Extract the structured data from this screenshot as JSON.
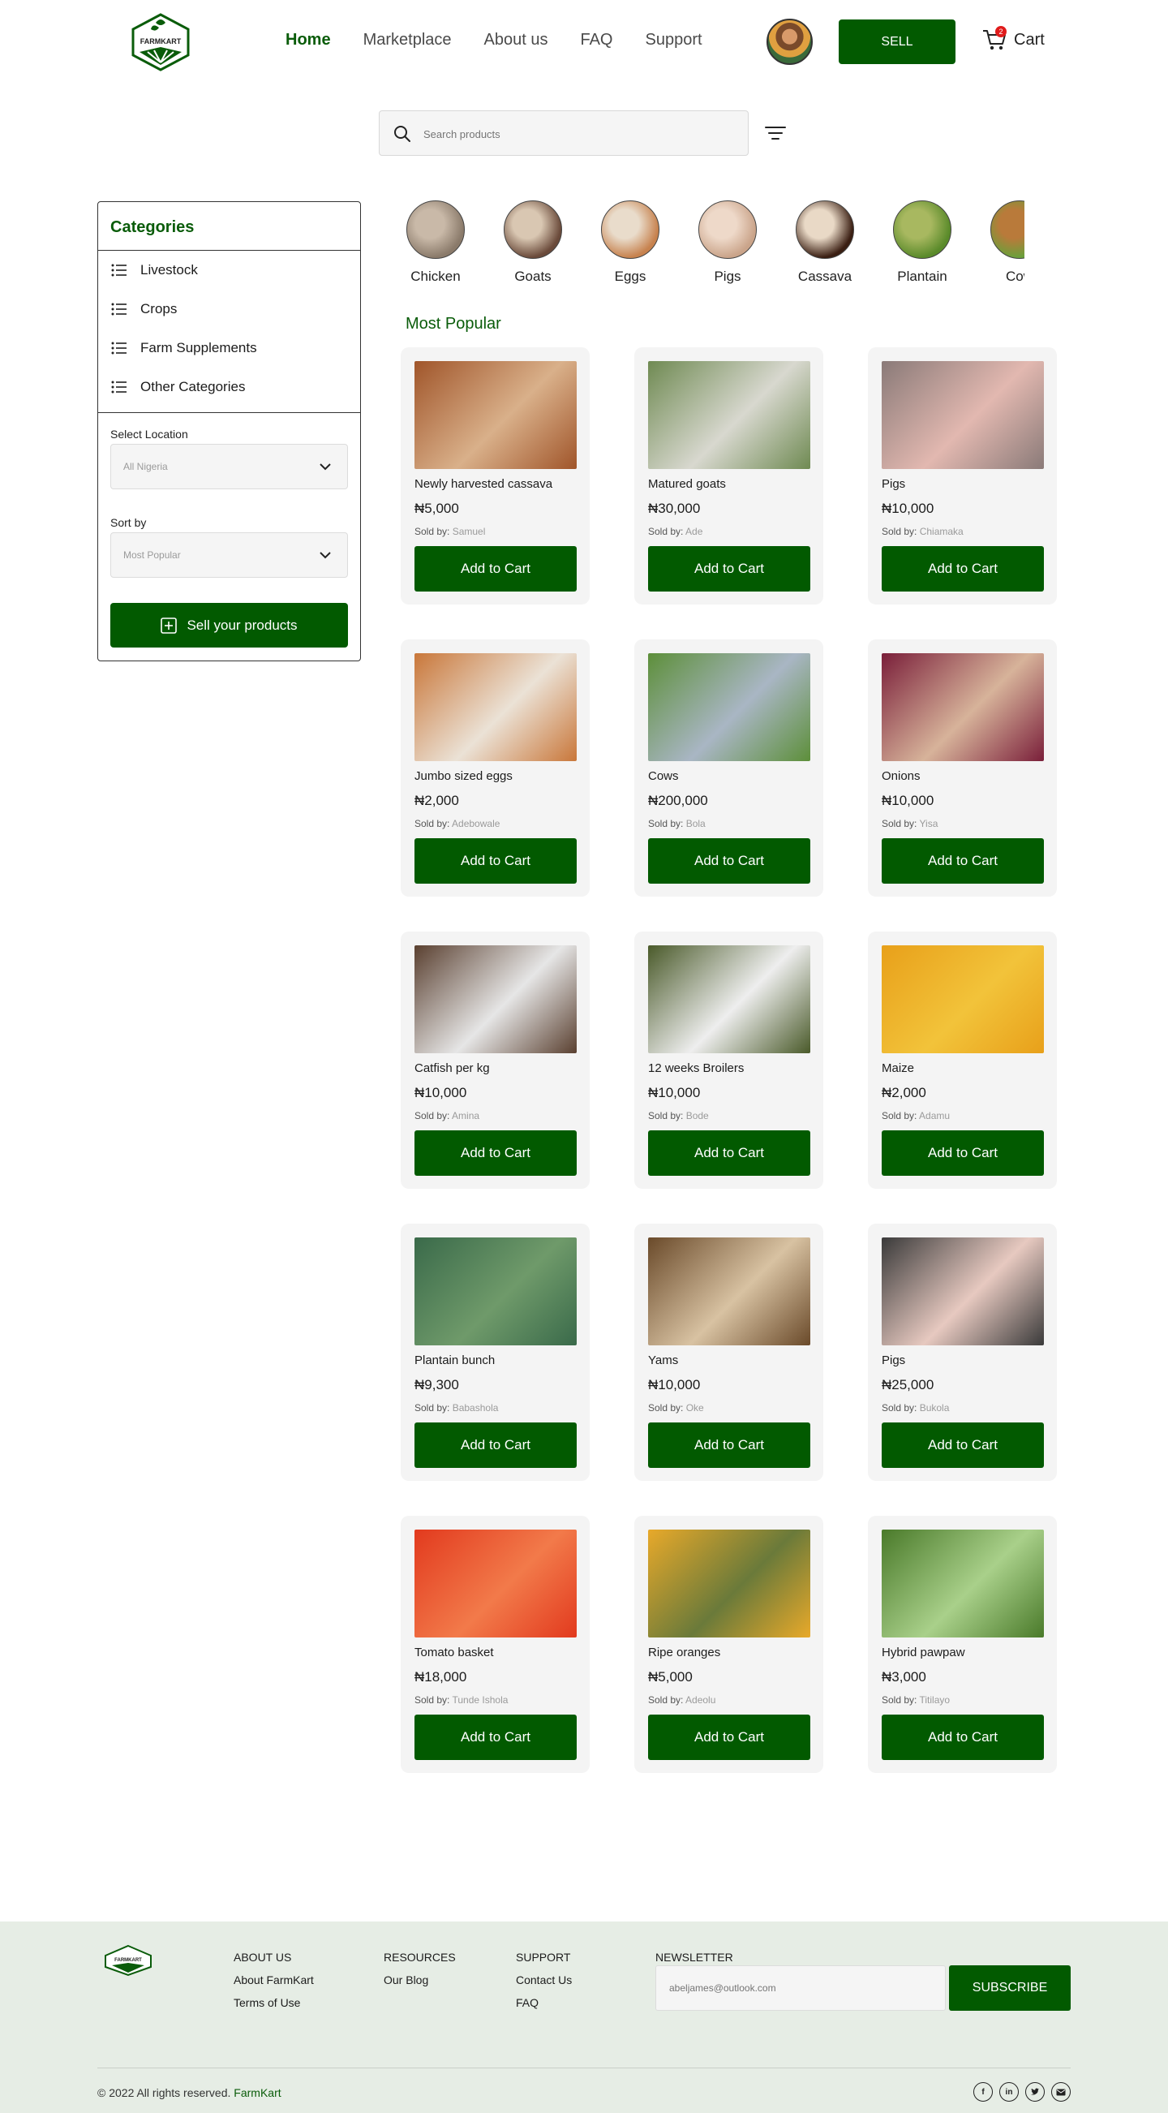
{
  "header": {
    "logo_text": "FARMKART",
    "nav": [
      {
        "label": "Home",
        "active": true
      },
      {
        "label": "Marketplace",
        "active": false
      },
      {
        "label": "About us",
        "active": false
      },
      {
        "label": "FAQ",
        "active": false
      },
      {
        "label": "Support",
        "active": false
      }
    ],
    "sell_label": "SELL",
    "cart_label": "Cart",
    "cart_count": "2"
  },
  "search": {
    "placeholder": "Search products"
  },
  "sidebar": {
    "title": "Categories",
    "categories": [
      "Livestock",
      "Crops",
      "Farm Supplements",
      "Other Categories"
    ],
    "location_label": "Select Location",
    "location_value": "All Nigeria",
    "sort_label": "Sort by",
    "sort_value": "Most Popular",
    "sell_button": "Sell your products"
  },
  "category_strip": [
    {
      "label": "Chicken",
      "colors": [
        "#8a7a6a",
        "#c9b9a8"
      ]
    },
    {
      "label": "Goats",
      "colors": [
        "#6a4a3a",
        "#d9c7b2"
      ]
    },
    {
      "label": "Eggs",
      "colors": [
        "#c7824e",
        "#e9dccb"
      ]
    },
    {
      "label": "Pigs",
      "colors": [
        "#caa48a",
        "#eed9c9"
      ]
    },
    {
      "label": "Cassava",
      "colors": [
        "#3a1e12",
        "#e9d9c6"
      ]
    },
    {
      "label": "Plantain",
      "colors": [
        "#5a8a2a",
        "#a8b860"
      ]
    },
    {
      "label": "Cow",
      "colors": [
        "#6aa03a",
        "#b97a3a"
      ]
    }
  ],
  "section_title": "Most Popular",
  "products": [
    {
      "title": "Newly harvested cassava",
      "price": "₦5,000",
      "seller": "Samuel",
      "colors": [
        "#a0552a",
        "#d9b08a"
      ]
    },
    {
      "title": "Matured goats",
      "price": "₦30,000",
      "seller": "Ade",
      "colors": [
        "#6f8a52",
        "#d8d8cf"
      ]
    },
    {
      "title": "Pigs",
      "price": "₦10,000",
      "seller": "Chiamaka",
      "colors": [
        "#8a7a78",
        "#e2b8b0"
      ]
    },
    {
      "title": "Jumbo sized eggs",
      "price": "₦2,000",
      "seller": "Adebowale",
      "colors": [
        "#c9773a",
        "#ebe2d6"
      ]
    },
    {
      "title": "Cows",
      "price": "₦200,000",
      "seller": "Bola",
      "colors": [
        "#5d8f3a",
        "#a9b6c4"
      ]
    },
    {
      "title": "Onions",
      "price": "₦10,000",
      "seller": "Yisa",
      "colors": [
        "#7a1f3a",
        "#d7b39a"
      ]
    },
    {
      "title": "Catfish per kg",
      "price": "₦10,000",
      "seller": "Amina",
      "colors": [
        "#5a4030",
        "#e6e6e6"
      ]
    },
    {
      "title": "12 weeks Broilers",
      "price": "₦10,000",
      "seller": "Bode",
      "colors": [
        "#4a5a2a",
        "#eeeeee"
      ]
    },
    {
      "title": "Maize",
      "price": "₦2,000",
      "seller": "Adamu",
      "colors": [
        "#e8a01a",
        "#f2c33a"
      ]
    },
    {
      "title": "Plantain bunch",
      "price": "₦9,300",
      "seller": "Babashola",
      "colors": [
        "#3a6a4a",
        "#6f9a6a"
      ]
    },
    {
      "title": "Yams",
      "price": "₦10,000",
      "seller": "Oke",
      "colors": [
        "#6a4a2a",
        "#d8c2a2"
      ]
    },
    {
      "title": "Pigs",
      "price": "₦25,000",
      "seller": "Bukola",
      "colors": [
        "#3a3a3a",
        "#e7c9c0"
      ]
    },
    {
      "title": "Tomato basket",
      "price": "₦18,000",
      "seller": "Tunde Ishola",
      "colors": [
        "#e23a1e",
        "#f27a4a"
      ]
    },
    {
      "title": "Ripe oranges",
      "price": "₦5,000",
      "seller": "Adeolu",
      "colors": [
        "#e8a92a",
        "#6a7a3a"
      ]
    },
    {
      "title": "Hybrid pawpaw",
      "price": "₦3,000",
      "seller": "Titilayo",
      "colors": [
        "#4a7a2a",
        "#a9d08a"
      ]
    }
  ],
  "card_button": "Add to Cart",
  "sold_by_label": "Sold by:",
  "footer": {
    "columns": [
      {
        "title": "ABOUT US",
        "links": [
          "About FarmKart",
          "Terms of Use"
        ]
      },
      {
        "title": "RESOURCES",
        "links": [
          "Our Blog"
        ]
      },
      {
        "title": "SUPPORT",
        "links": [
          "Contact Us",
          "FAQ"
        ]
      }
    ],
    "newsletter_title": "NEWSLETTER",
    "newsletter_placeholder": "abeljames@outlook.com",
    "subscribe_label": "SUBSCRIBE",
    "copyright": "© 2022 All rights reserved.",
    "brand": "FarmKart",
    "socials": [
      "facebook-icon",
      "linkedin-icon",
      "twitter-icon",
      "mail-icon"
    ]
  },
  "colors": {
    "brand_green": "#025a00",
    "accent_green": "#0a5c0a",
    "badge_red": "#e01b1b",
    "footer_bg": "#e6ede5"
  }
}
